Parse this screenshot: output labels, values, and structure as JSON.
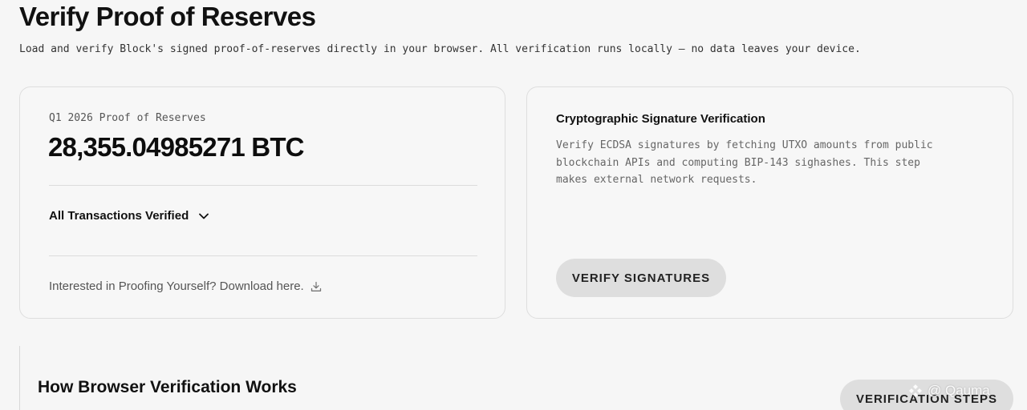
{
  "header": {
    "title": "Verify Proof of Reserves",
    "subtitle": "Load and verify Block's signed proof-of-reserves directly in your browser. All verification runs locally — no data leaves your device."
  },
  "reserves_card": {
    "label": "Q1 2026 Proof of Reserves",
    "amount": "28,355.04985271 BTC",
    "transactions_toggle": "All Transactions Verified",
    "download_text": "Interested in Proofing Yourself? Download here."
  },
  "signature_card": {
    "title": "Cryptographic Signature Verification",
    "description_lines": [
      "Verify ECDSA signatures by fetching UTXO amounts from public",
      "blockchain APIs and computing BIP-143 sighashes. This step",
      "makes external network requests."
    ],
    "button_label": "VERIFY SIGNATURES"
  },
  "how_section": {
    "title": "How Browser Verification Works",
    "button_label": "VERIFICATION STEPS"
  },
  "watermark": {
    "text": "@ Qauma"
  },
  "icons": {
    "chevron": "chevron-down-icon",
    "download": "download-icon"
  }
}
